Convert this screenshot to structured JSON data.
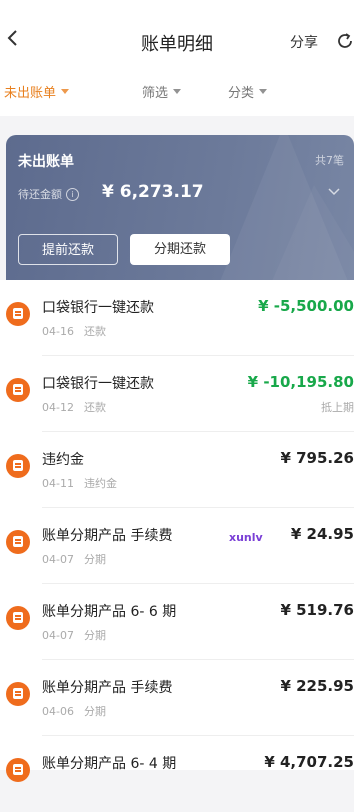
{
  "header": {
    "title": "账单明细",
    "share": "分享"
  },
  "filters": [
    {
      "label": "未出账单"
    },
    {
      "label": "筛选"
    },
    {
      "label": "分类"
    }
  ],
  "summary": {
    "title": "未出账单",
    "count": "共7笔",
    "label": "待还金额",
    "amount": "¥ 6,273.17",
    "buttons": {
      "early": "提前还款",
      "installment": "分期还款"
    }
  },
  "transactions": [
    {
      "name": "口袋银行一键还款",
      "date": "04-16",
      "type": "还款",
      "amount": "¥ -5,500.00",
      "note": ""
    },
    {
      "name": "口袋银行一键还款",
      "date": "04-12",
      "type": "还款",
      "amount": "¥ -10,195.80",
      "note": "抵上期"
    },
    {
      "name": "违约金",
      "date": "04-11",
      "type": "违约金",
      "amount": "¥ 795.26",
      "note": ""
    },
    {
      "name": "账单分期产品 手续费",
      "date": "04-07",
      "type": "分期",
      "amount": "¥ 24.95",
      "note": ""
    },
    {
      "name": "账单分期产品 6- 6 期",
      "date": "04-07",
      "type": "分期",
      "amount": "¥ 519.76",
      "note": ""
    },
    {
      "name": "账单分期产品 手续费",
      "date": "04-06",
      "type": "分期",
      "amount": "¥ 225.95",
      "note": ""
    },
    {
      "name": "账单分期产品 6- 4 期",
      "date": "",
      "type": "",
      "amount": "¥ 4,707.25",
      "note": ""
    }
  ],
  "watermark": "xunlv",
  "colors": {
    "accent": "#e8801f",
    "green": "#18a84a",
    "icon": "#ef6c1d",
    "card": "#6c7a9a"
  }
}
